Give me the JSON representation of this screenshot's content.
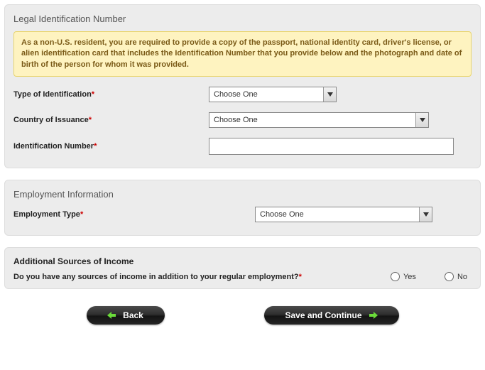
{
  "legal": {
    "title": "Legal Identification Number",
    "notice": "As a non-U.S. resident, you are required to provide a copy of the passport, national identity card, driver's license, or alien identification card that includes the Identification Number that you provide below and the photograph and date of birth of the person for whom it was provided.",
    "type_label": "Type of Identification",
    "type_value": "Choose One",
    "country_label": "Country of Issuance",
    "country_value": "Choose One",
    "idnum_label": "Identification Number",
    "idnum_value": ""
  },
  "employment": {
    "title": "Employment Information",
    "type_label": "Employment Type",
    "type_value": "Choose One"
  },
  "income": {
    "heading": "Additional Sources of Income",
    "question": "Do you have any sources of income in addition to your regular employment?",
    "yes": "Yes",
    "no": "No"
  },
  "buttons": {
    "back": "Back",
    "next": "Save and Continue"
  },
  "req": "*"
}
